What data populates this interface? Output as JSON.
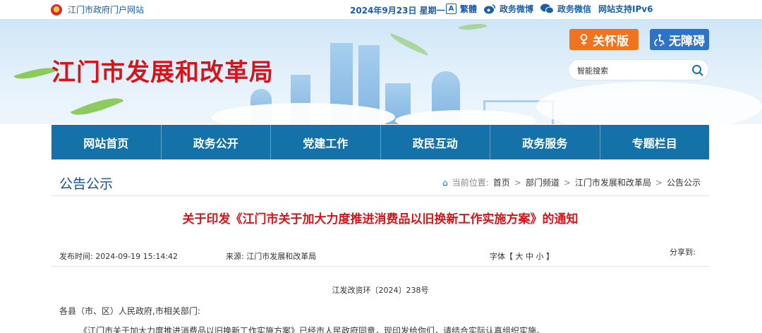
{
  "topbar": {
    "site_name": "江门市政府门户网站",
    "date": "2024年9月23日 星期一",
    "links": [
      {
        "label": "繁體",
        "icon": "traditional-chinese-icon"
      },
      {
        "label": "政务微博",
        "icon": "weibo-icon"
      },
      {
        "label": "政务微信",
        "icon": "wechat-icon"
      },
      {
        "label": "网站支持IPv6",
        "icon": ""
      }
    ]
  },
  "banner": {
    "org_title": "江门市发展和改革局",
    "care_label": "关怀版",
    "accessibility_label": "无障碍",
    "search_placeholder": "智能搜索"
  },
  "nav": {
    "items": [
      "网站首页",
      "政务公开",
      "党建工作",
      "政民互动",
      "政务服务",
      "专题栏目"
    ]
  },
  "section": {
    "title": "公告公示",
    "crumb_label": "当前位置:",
    "crumbs": [
      "首页",
      "部门频道",
      "江门市发展和改革局",
      "公告公示"
    ],
    "crumb_sep": ">"
  },
  "article": {
    "title": "关于印发《江门市关于加大力度推进消费品以旧换新工作实施方案》的通知",
    "publish_time": "发布时间:  2024-09-19 15:14:42",
    "source": "来源:  江门市发展和改革局",
    "font_size_ctrl": "字体【 大  中  小 】",
    "share": "分享到:",
    "doc_no": "江发改资环〔2024〕238号",
    "salutation": "各县（市、区）人民政府,市相关部门:",
    "body": "《江门市关于加大力度推进消费品以旧换新工作实施方案》已经市人民政府同意，现印发给你们，请结合实际认真组织实施。"
  },
  "colors": {
    "brand_red": "#d8141b",
    "nav_blue": "#1572a8",
    "care_orange": "#f0741f",
    "accessibility_blue": "#2f73c9"
  }
}
